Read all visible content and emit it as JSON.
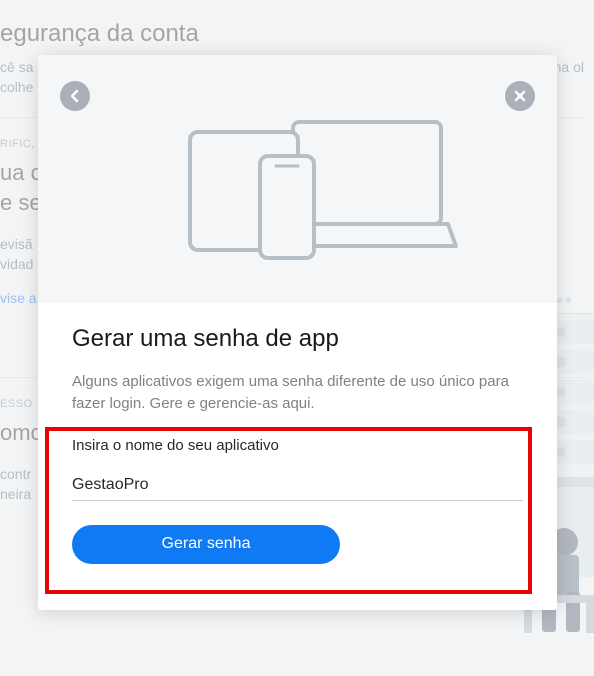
{
  "bg": {
    "title": "egurança da conta",
    "sub1": "cê sa",
    "sub1b": "ma ol",
    "sub2": "colhe",
    "section1": {
      "eyebrow": "RIFIC,",
      "h2a": "ua c",
      "h2b": "e se",
      "p1": "evisã",
      "p2": "vidad",
      "link": "vise a"
    },
    "section2": {
      "eyebrow": "ESSO",
      "h2": "omc",
      "p1": "contr",
      "p2": "neira"
    }
  },
  "modal": {
    "title": "Gerar uma senha de app",
    "desc": "Alguns aplicativos exigem uma senha diferente de uso único para fazer login. Gere e gerencie-as aqui.",
    "field_label": "Insira o nome do seu aplicativo",
    "input_value": "GestaoPro",
    "button_label": "Gerar senha"
  }
}
